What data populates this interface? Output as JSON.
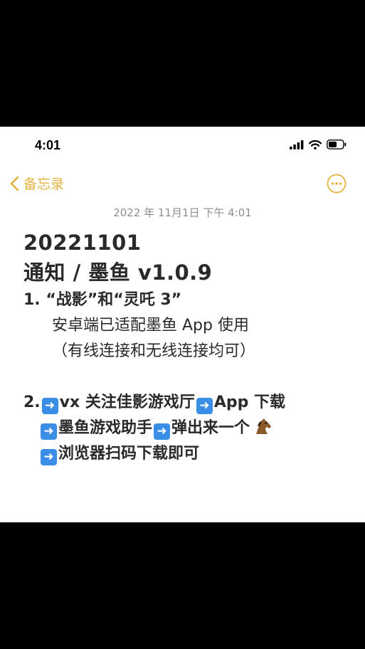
{
  "status": {
    "time": "4:01"
  },
  "nav": {
    "back_label": "备忘录"
  },
  "note": {
    "date": "2022 年 11月1日  下午 4:01",
    "title1": "20221101",
    "title2": "通知 / 墨鱼 v1.0.9",
    "item1_line1": "1. “战影”和“灵吒 3”",
    "item1_line2": "安卓端已适配墨鱼 App 使用",
    "item1_line3": "（有线连接和无线连接均可）",
    "item2_prefix": "2.",
    "item2_seg1": "vx 关注佳影游戏厅",
    "item2_seg2": "App 下载",
    "item2_seg3": "墨鱼游戏助手",
    "item2_seg4": "弹出来一个",
    "item2_seg5": "浏览器扫码下载即可"
  },
  "icons": [
    "signal-icon",
    "wifi-icon",
    "battery-icon",
    "chevron-left-icon",
    "more-icon",
    "right-arrow-emoji",
    "horse-emoji"
  ],
  "colors": {
    "accent": "#E2B33E",
    "arrow_box": "#3a8ee6",
    "date_text": "#8e8e93"
  }
}
